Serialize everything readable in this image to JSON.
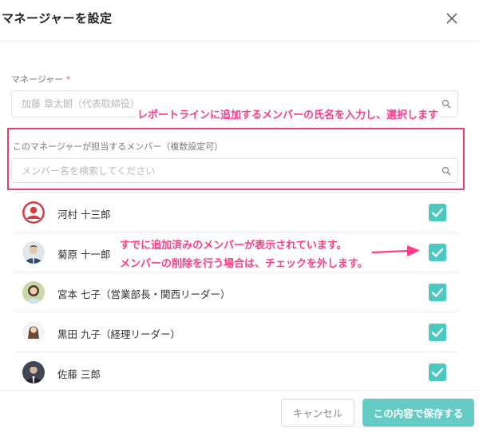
{
  "modal": {
    "title": "マネージャーを設定"
  },
  "manager_field": {
    "label": "マネージャー",
    "required_mark": "*",
    "placeholder": "加藤 章太朗（代表取締役）"
  },
  "members_field": {
    "label": "このマネージャーが担当するメンバー（複数設定可）",
    "placeholder": "メンバー名を検索してください"
  },
  "annotations": {
    "search_hint": "レポートラインに追加するメンバーの氏名を入力し、選択します",
    "list_hint_line1": "すでに追加済みのメンバーが表示されています。",
    "list_hint_line2": "メンバーの削除を行う場合は、チェックを外します。",
    "color": "#ff3b8a"
  },
  "members": [
    {
      "name": "河村 十三郎",
      "checked": true,
      "avatar": "default-user-icon"
    },
    {
      "name": "菊原 十一郎",
      "checked": true,
      "avatar": "man-photo"
    },
    {
      "name": "宮本 七子（営業部長・関西リーダー）",
      "checked": true,
      "avatar": "woman-photo"
    },
    {
      "name": "黒田 九子（経理リーダー）",
      "checked": true,
      "avatar": "woman-photo"
    },
    {
      "name": "佐藤 三郎",
      "checked": true,
      "avatar": "man-photo"
    }
  ],
  "footer": {
    "cancel_label": "キャンセル",
    "save_label": "この内容で保存する"
  },
  "colors": {
    "accent": "#4bc8c0",
    "save_button": "#64ccc5",
    "highlight": "#e8416e",
    "required": "#e8566f"
  }
}
